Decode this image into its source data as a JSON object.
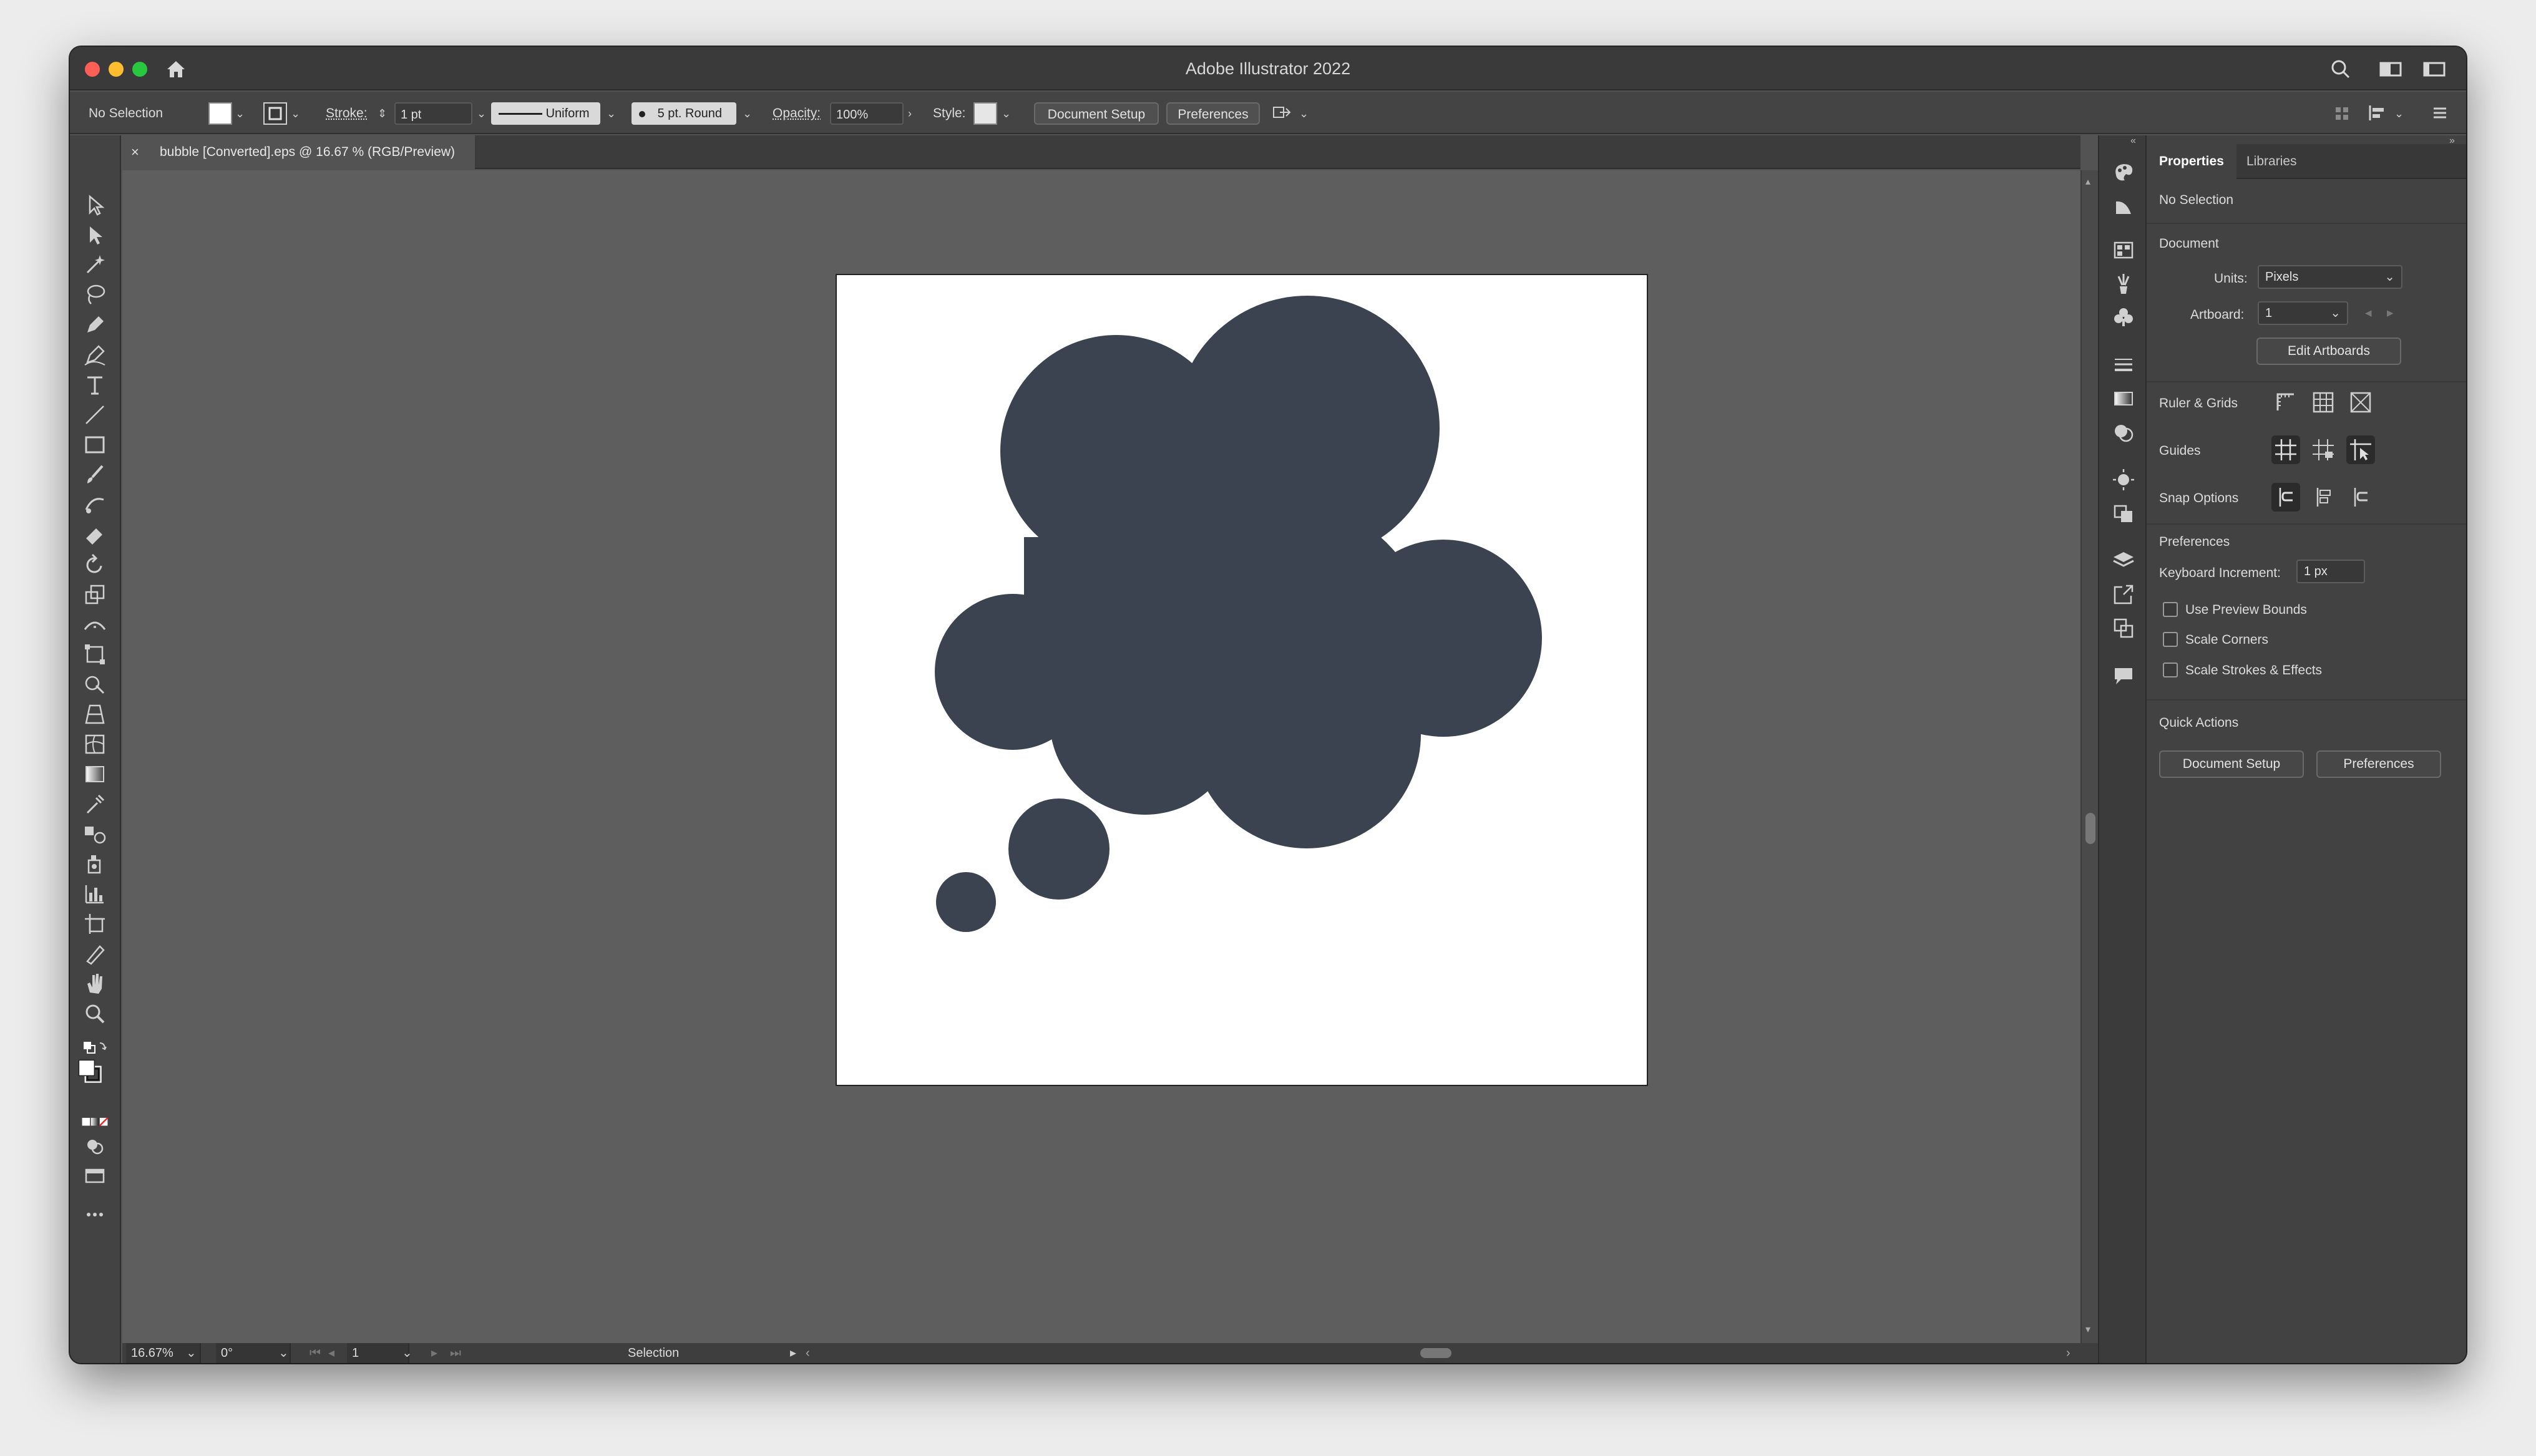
{
  "app": {
    "title": "Adobe Illustrator 2022"
  },
  "control_bar": {
    "selection_label": "No Selection",
    "stroke_label": "Stroke:",
    "stroke_value": "1 pt",
    "stroke_profile": "Uniform",
    "brush": "5 pt. Round",
    "opacity_label": "Opacity:",
    "opacity_value": "100%",
    "style_label": "Style:",
    "document_setup_button": "Document Setup",
    "preferences_button": "Preferences"
  },
  "document": {
    "tab_title": "bubble [Converted].eps @ 16.67 % (RGB/Preview)",
    "close_glyph": "×",
    "artboard_fill": "#ffffff",
    "bubble_color": "#3b4350"
  },
  "status_bar": {
    "zoom": "16.67%",
    "rotation": "0°",
    "artboard_number": "1",
    "tool_name": "Selection"
  },
  "panel": {
    "tabs": [
      "Properties",
      "Libraries"
    ],
    "selection_state": "No Selection",
    "document_heading": "Document",
    "units_label": "Units:",
    "units_value": "Pixels",
    "artboard_label": "Artboard:",
    "artboard_value": "1",
    "edit_artboards_button": "Edit Artboards",
    "ruler_grids_label": "Ruler & Grids",
    "guides_label": "Guides",
    "snap_options_label": "Snap Options",
    "preferences_heading": "Preferences",
    "keyboard_increment_label": "Keyboard Increment:",
    "keyboard_increment_value": "1 px",
    "checkboxes": [
      "Use Preview Bounds",
      "Scale Corners",
      "Scale Strokes & Effects"
    ],
    "quick_actions_heading": "Quick Actions",
    "quick_document_setup": "Document Setup",
    "quick_preferences": "Preferences"
  },
  "colors": {
    "ui_dark": "#535353",
    "canvas_bg": "#5e5e5e",
    "accent_red": "#ff5f57",
    "accent_yellow": "#febc2e",
    "accent_green": "#28c840"
  },
  "icons": {
    "tools": [
      "selection-icon",
      "direct-selection-icon",
      "magic-wand-icon",
      "lasso-icon",
      "pen-icon",
      "curvature-icon",
      "type-icon",
      "line-segment-icon",
      "rectangle-icon",
      "paintbrush-icon",
      "shaper-icon",
      "eraser-icon",
      "rotate-icon",
      "scale-icon",
      "width-icon",
      "free-transform-icon",
      "shape-builder-icon",
      "perspective-grid-icon",
      "mesh-icon",
      "gradient-icon",
      "eyedropper-icon",
      "blend-icon",
      "symbol-sprayer-icon",
      "column-graph-icon",
      "artboard-icon",
      "slice-icon",
      "hand-icon",
      "zoom-icon"
    ],
    "strip": [
      "color-icon",
      "color-guide-icon",
      "swatches-icon",
      "brushes-icon",
      "symbols-icon",
      "stroke-icon",
      "gradient-panel-icon",
      "transparency-icon",
      "appearance-icon",
      "graphic-styles-icon",
      "layers-icon",
      "asset-export-icon",
      "artboards-panel-icon",
      "comments-icon"
    ]
  }
}
